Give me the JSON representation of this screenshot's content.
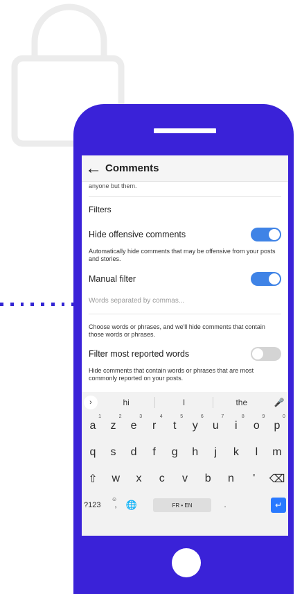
{
  "header": {
    "back_icon": "arrow-left-icon",
    "title": "Comments"
  },
  "settings": {
    "clipped_text": "anyone but them.",
    "section_title": "Filters",
    "items": [
      {
        "label": "Hide offensive comments",
        "enabled": true,
        "note": "Automatically hide comments that may be offensive from your posts and stories."
      },
      {
        "label": "Manual filter",
        "enabled": true,
        "input_placeholder": "Words separated by commas...",
        "note": "Choose words or phrases, and we'll hide comments that contain those words or phrases."
      },
      {
        "label": "Filter most reported words",
        "enabled": false,
        "note": "Hide comments that contain words or phrases that are most commonly reported on your posts."
      }
    ]
  },
  "keyboard": {
    "suggestions": [
      "hi",
      "I",
      "the"
    ],
    "row1": [
      {
        "k": "a",
        "n": "1"
      },
      {
        "k": "z",
        "n": "2"
      },
      {
        "k": "e",
        "n": "3"
      },
      {
        "k": "r",
        "n": "4"
      },
      {
        "k": "t",
        "n": "5"
      },
      {
        "k": "y",
        "n": "6"
      },
      {
        "k": "u",
        "n": "7"
      },
      {
        "k": "i",
        "n": "8"
      },
      {
        "k": "o",
        "n": "9"
      },
      {
        "k": "p",
        "n": "0"
      }
    ],
    "row2": [
      "q",
      "s",
      "d",
      "f",
      "g",
      "h",
      "j",
      "k",
      "l",
      "m"
    ],
    "row3": [
      "w",
      "x",
      "c",
      "v",
      "b",
      "n",
      "'"
    ],
    "symbols_key": "?123",
    "comma_key": ",",
    "space_label": "FR • EN",
    "period_key": "."
  },
  "colors": {
    "phone": "#3a22d8",
    "toggle_on": "#3f83e6",
    "toggle_off": "#d4d4d4",
    "enter": "#2979ff",
    "dash": "#3325d3"
  }
}
